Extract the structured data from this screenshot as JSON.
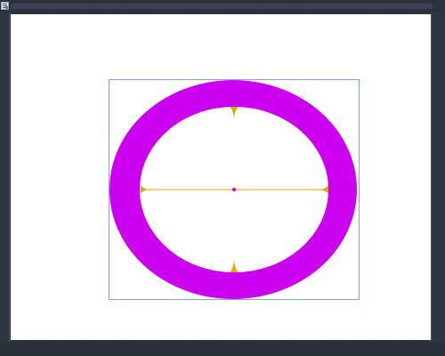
{
  "window": {
    "title": ""
  },
  "toolbar": {
    "app_icon_name": "app-menu-icon"
  },
  "canvas": {
    "background_color": "#ffffff"
  },
  "shape": {
    "type": "ellipse-ring",
    "fill_color": "#cc00ee",
    "selection_border_color": "#7aa2f0",
    "guide_color": "#e0a800",
    "center_dot_color": "#cc00ee"
  }
}
